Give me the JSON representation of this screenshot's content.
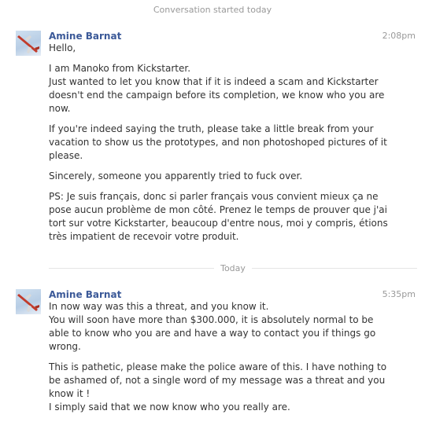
{
  "conversation": {
    "started_label": "Conversation started today"
  },
  "messages": [
    {
      "author": "Amine Barnat",
      "time": "2:08pm",
      "paragraphs": [
        "Hello,",
        "I am Manoko from Kickstarter.\nJust wanted to let you know that if it is indeed a scam and Kickstarter doesn't end the campaign before its completion, we know who you are now.",
        "If you're indeed saying the truth, please take a little break from your vacation to show us the prototypes, and non photoshoped pictures of it please.",
        "Sincerely, someone you apparently tried to fuck over.",
        "PS: Je suis français, donc si parler français vous convient mieux ça ne pose aucun problème de mon côté. Prenez le temps de prouver que j'ai tort sur votre Kickstarter, beaucoup d'entre nous, moi y compris, étions très impatient de recevoir votre produit."
      ]
    },
    {
      "author": "Amine Barnat",
      "time": "5:35pm",
      "paragraphs": [
        "In now way was this a threat, and you know it.\nYou will soon have more than $300.000, it is absolutely normal to be able to know who you are and have a way to contact you if things go wrong.",
        "This is pathetic, please make the police aware of this. I have nothing to be ashamed of, not a single word of my message was a threat and you know it !\nI simply said that we now know who you really are."
      ]
    }
  ],
  "divider": {
    "label": "Today"
  },
  "icons": {
    "avatar": "avatar-airplane-icon"
  }
}
